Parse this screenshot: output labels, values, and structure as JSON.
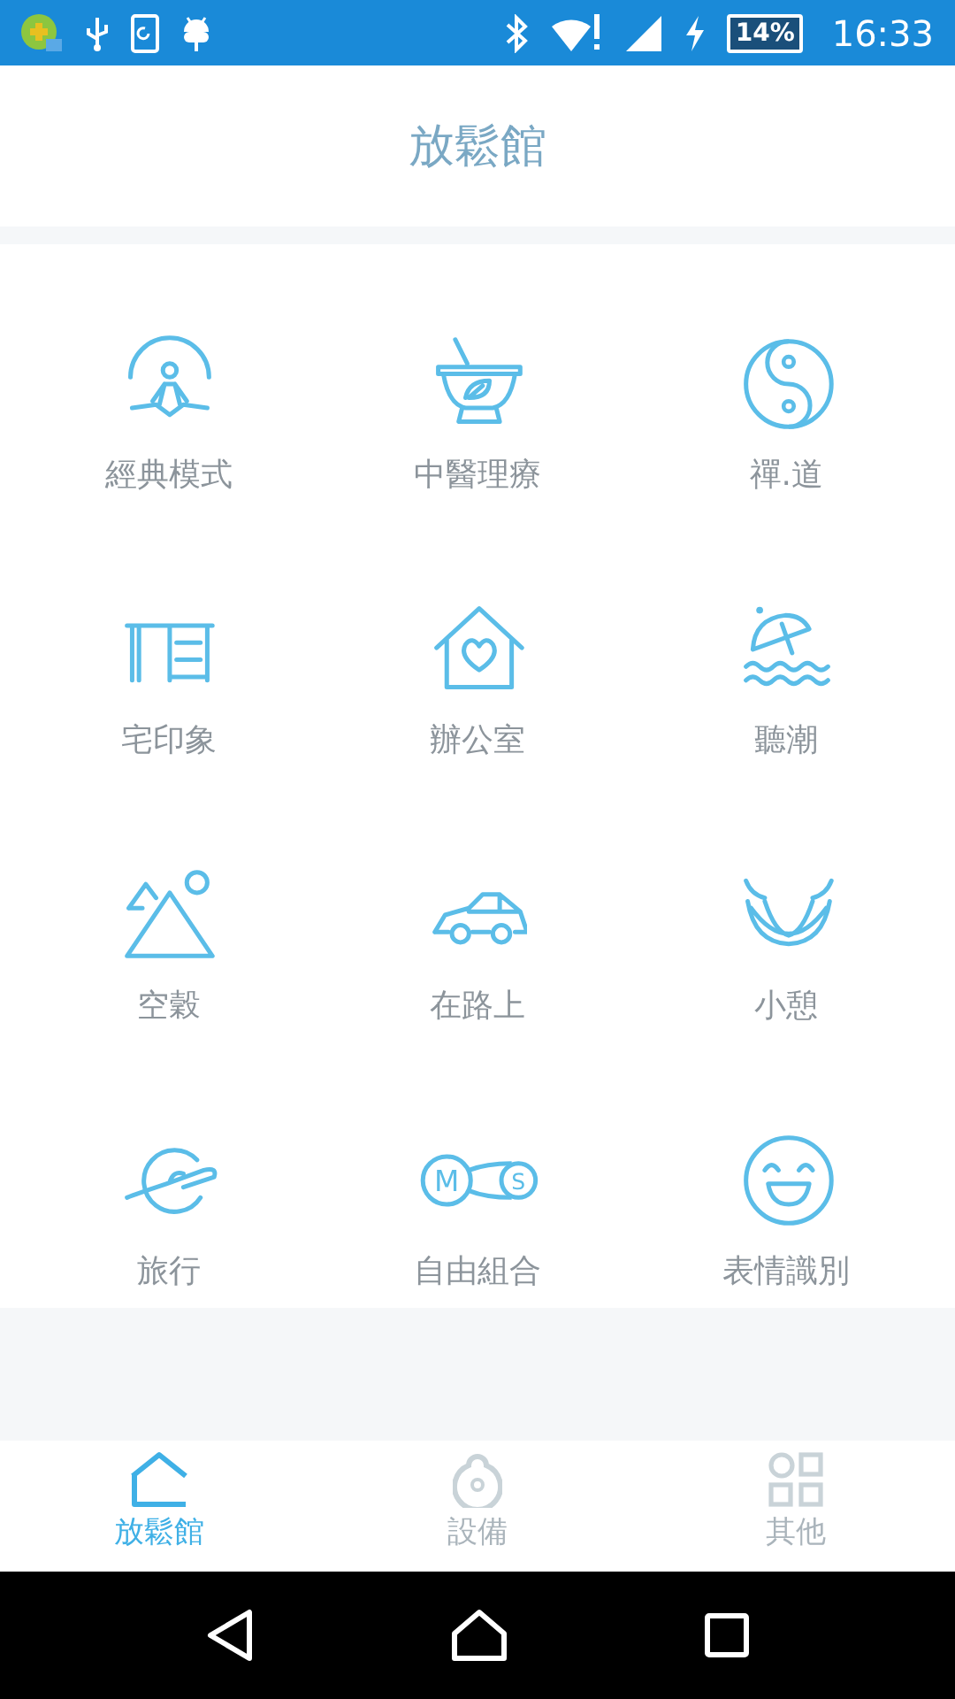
{
  "status_bar": {
    "battery": "14%",
    "time": "16:33"
  },
  "header": {
    "title": "放鬆館"
  },
  "modes": [
    {
      "kind": "meditation",
      "label": "經典模式"
    },
    {
      "kind": "herb-bowl",
      "label": "中醫理療"
    },
    {
      "kind": "yin-yang",
      "label": "禪.道"
    },
    {
      "kind": "desk",
      "label": "宅印象"
    },
    {
      "kind": "house-heart",
      "label": "辦公室"
    },
    {
      "kind": "beach",
      "label": "聽潮"
    },
    {
      "kind": "mountains",
      "label": "空穀"
    },
    {
      "kind": "car",
      "label": "在路上"
    },
    {
      "kind": "hammock",
      "label": "小憩"
    },
    {
      "kind": "plane-globe",
      "label": "旅行"
    },
    {
      "kind": "link",
      "label": "自由組合"
    },
    {
      "kind": "smiley",
      "label": "表情識別"
    }
  ],
  "link_icon_letters": [
    "M",
    "S"
  ],
  "bottom_nav": [
    {
      "kind": "home",
      "label": "放鬆館",
      "selected": true
    },
    {
      "kind": "device",
      "label": "設備",
      "selected": false
    },
    {
      "kind": "grid",
      "label": "其他",
      "selected": false
    }
  ]
}
